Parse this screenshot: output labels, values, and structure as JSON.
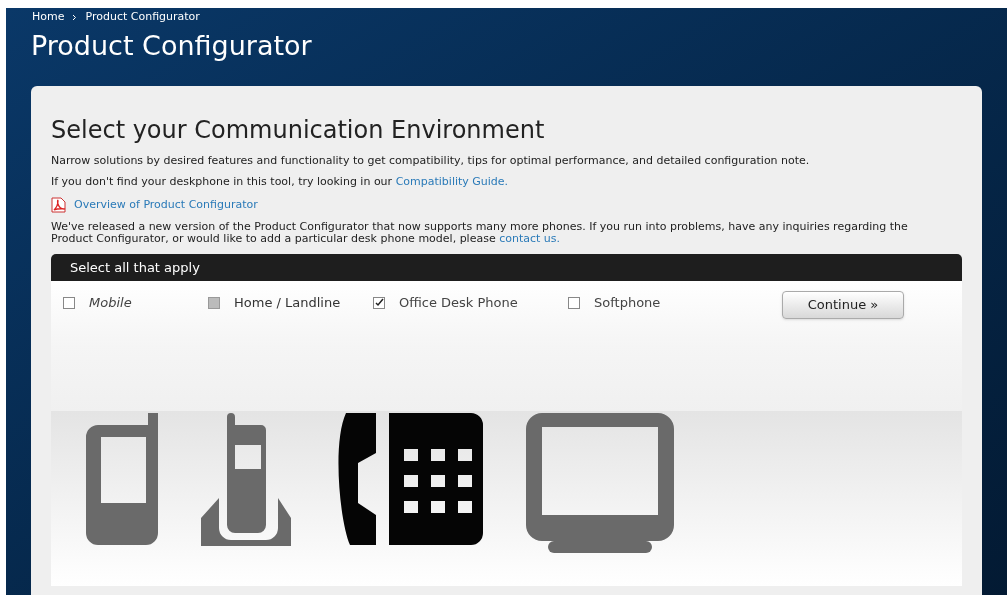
{
  "breadcrumb": [
    "Home",
    "Product Configurator"
  ],
  "page_title": "Product Configurator",
  "section": {
    "heading": "Select your Communication Environment",
    "intro": "Narrow solutions by desired features and functionality to get compatibility, tips for optimal performance, and detailed configuration note.",
    "guide_text": "If you don't find your deskphone in this tool, try looking in our",
    "guide_link": "Compatibility Guide.",
    "overview_link": "Overview of Product Configurator",
    "notice_text": "We've released a new version of the Product Configurator that now supports many more phones. If you run into problems, have any inquiries regarding the Product Configurator, or would like to add a particular desk phone model, please",
    "notice_link": "contact us."
  },
  "selector": {
    "title": "Select all that apply",
    "options": [
      {
        "label": "Mobile",
        "kind": "mobile",
        "checked": false,
        "disabled": false
      },
      {
        "label": "Home / Landline",
        "kind": "cordless",
        "checked": false,
        "disabled": true
      },
      {
        "label": "Office Desk Phone",
        "kind": "desk",
        "checked": true,
        "disabled": false
      },
      {
        "label": "Softphone",
        "kind": "monitor",
        "checked": false,
        "disabled": false
      }
    ],
    "continue_button": "Continue »"
  }
}
